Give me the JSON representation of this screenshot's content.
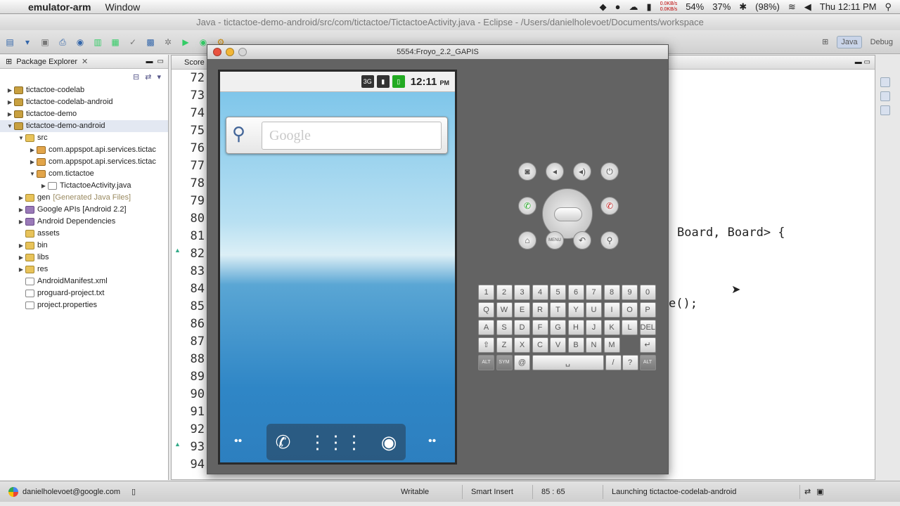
{
  "menubar": {
    "apple": "",
    "app_name": "emulator-arm",
    "menus": [
      "Window"
    ],
    "net_up": "0.0KB/s",
    "net_down": "0.0KB/s",
    "battery_cpu": "54%",
    "cpu2": "37%",
    "battery": "(98%)",
    "clock": "Thu 12:11 PM"
  },
  "window_title": "Java - tictactoe-demo-android/src/com/tictactoe/TictactoeActivity.java - Eclipse - /Users/danielholevoet/Documents/workspace",
  "perspectives": {
    "java": "Java",
    "debug": "Debug"
  },
  "package_explorer": {
    "title": "Package Explorer",
    "items": [
      {
        "label": "tictactoe-codelab",
        "indent": 0,
        "arrow": "▶",
        "icon": "proj"
      },
      {
        "label": "tictactoe-codelab-android",
        "indent": 0,
        "arrow": "▶",
        "icon": "proj"
      },
      {
        "label": "tictactoe-demo",
        "indent": 0,
        "arrow": "▶",
        "icon": "proj"
      },
      {
        "label": "tictactoe-demo-android",
        "indent": 0,
        "arrow": "▼",
        "icon": "proj"
      },
      {
        "label": "src",
        "indent": 1,
        "arrow": "▼",
        "icon": "folder"
      },
      {
        "label": "com.appspot.api.services.tictac",
        "indent": 2,
        "arrow": "▶",
        "icon": "pkgi"
      },
      {
        "label": "com.appspot.api.services.tictac",
        "indent": 2,
        "arrow": "▶",
        "icon": "pkgi"
      },
      {
        "label": "com.tictactoe",
        "indent": 2,
        "arrow": "▼",
        "icon": "pkgi"
      },
      {
        "label": "TictactoeActivity.java",
        "indent": 3,
        "arrow": "▶",
        "icon": "file"
      },
      {
        "label": "gen",
        "suffix": "[Generated Java Files]",
        "indent": 1,
        "arrow": "▶",
        "icon": "folder"
      },
      {
        "label": "Google APIs [Android 2.2]",
        "indent": 1,
        "arrow": "▶",
        "icon": "lib"
      },
      {
        "label": "Android Dependencies",
        "indent": 1,
        "arrow": "▶",
        "icon": "lib"
      },
      {
        "label": "assets",
        "indent": 1,
        "arrow": "",
        "icon": "folder"
      },
      {
        "label": "bin",
        "indent": 1,
        "arrow": "▶",
        "icon": "folder"
      },
      {
        "label": "libs",
        "indent": 1,
        "arrow": "▶",
        "icon": "folder"
      },
      {
        "label": "res",
        "indent": 1,
        "arrow": "▶",
        "icon": "folder"
      },
      {
        "label": "AndroidManifest.xml",
        "indent": 1,
        "arrow": "",
        "icon": "file"
      },
      {
        "label": "proguard-project.txt",
        "indent": 1,
        "arrow": "",
        "icon": "file"
      },
      {
        "label": "project.properties",
        "indent": 1,
        "arrow": "",
        "icon": "file"
      }
    ]
  },
  "editor": {
    "tab_label": "Score",
    "line_numbers": [
      "72",
      "73",
      "74",
      "75",
      "76",
      "77",
      "78",
      "79",
      "80",
      "81",
      "82",
      "83",
      "84",
      "85",
      "86",
      "87",
      "88",
      "89",
      "90",
      "91",
      "92",
      "93",
      "94"
    ],
    "code_fragment_1": "Board, Board> {",
    "code_fragment_2": "e();"
  },
  "emulator": {
    "title": "5554:Froyo_2.2_GAPIS",
    "status_time": "12:11",
    "status_ampm": "PM",
    "search_placeholder": "Google",
    "keyboard_rows": [
      [
        "1",
        "2",
        "3",
        "4",
        "5",
        "6",
        "7",
        "8",
        "9",
        "0"
      ],
      [
        "Q",
        "W",
        "E",
        "R",
        "T",
        "Y",
        "U",
        "I",
        "O",
        "P"
      ],
      [
        "A",
        "S",
        "D",
        "F",
        "G",
        "H",
        "J",
        "K",
        "L",
        "DEL"
      ],
      [
        "⇧",
        "Z",
        "X",
        "C",
        "V",
        "B",
        "N",
        "M",
        "↵"
      ]
    ],
    "keyboard_bottom": [
      "ALT",
      "SYM",
      "@",
      "␣",
      "/",
      "?",
      "ALT"
    ]
  },
  "status_bar": {
    "account": "danielholevoet@google.com",
    "writable": "Writable",
    "insert_mode": "Smart Insert",
    "position": "85 : 65",
    "launching": "Launching tictactoe-codelab-android"
  }
}
